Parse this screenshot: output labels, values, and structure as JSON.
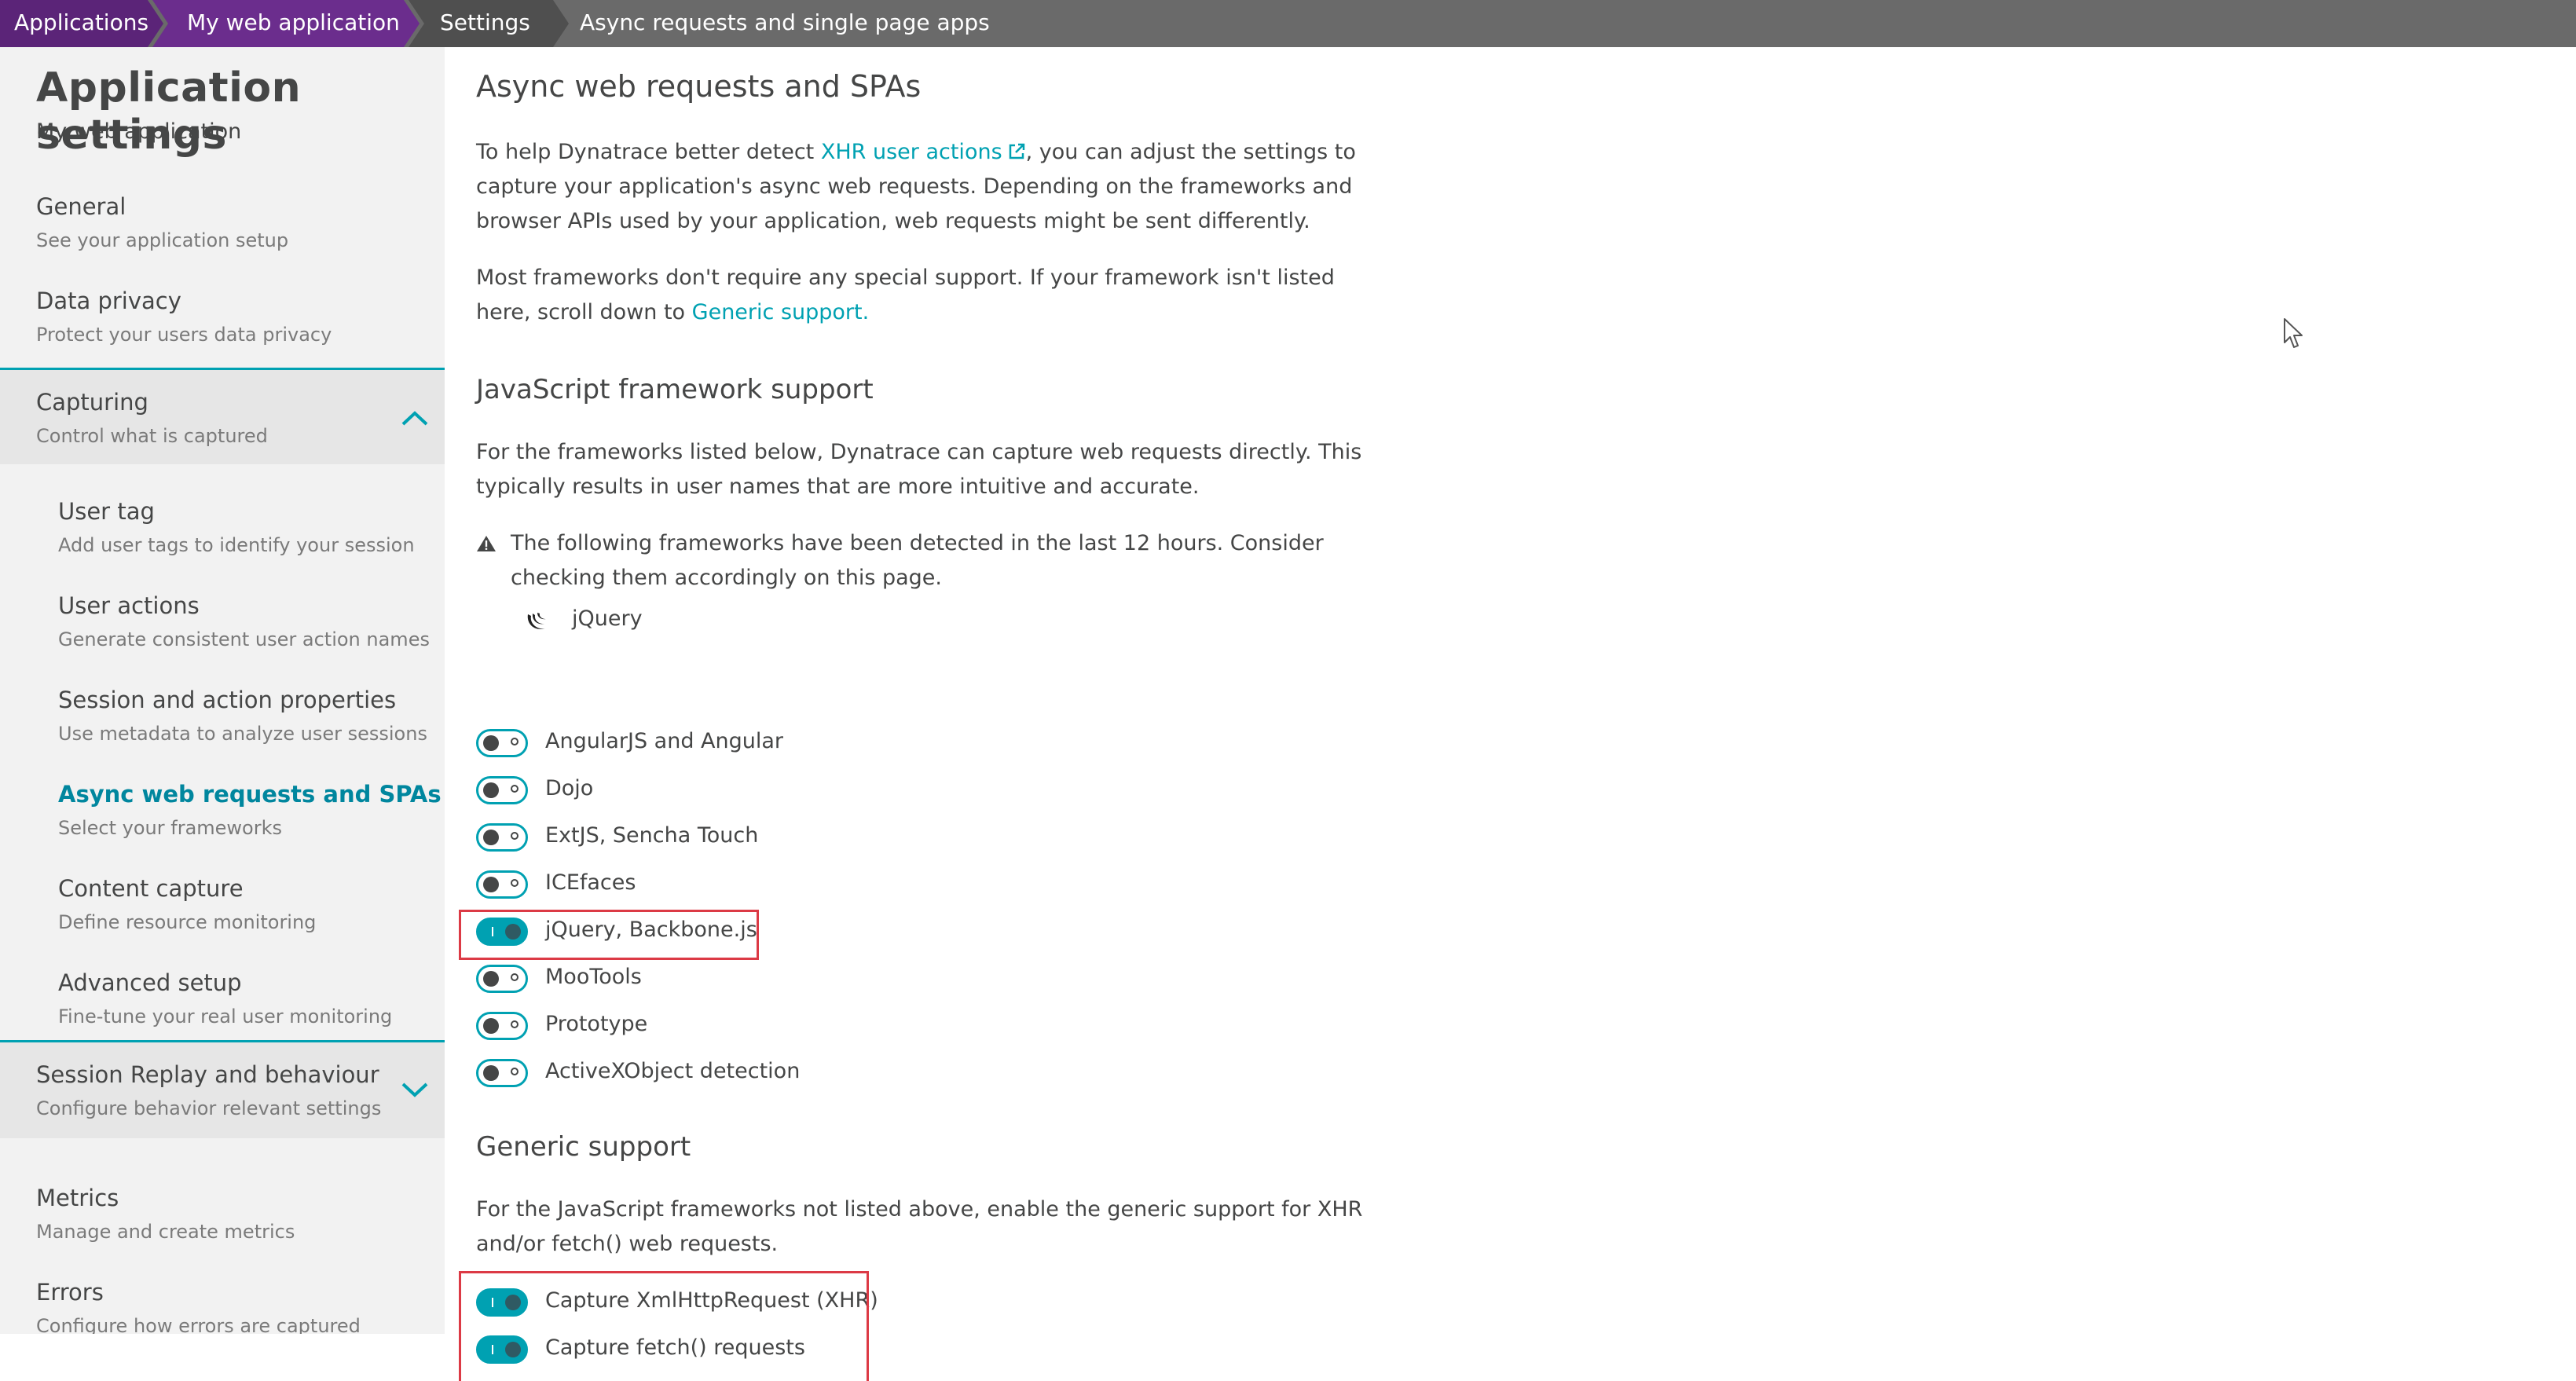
{
  "breadcrumb": {
    "items": [
      "Applications",
      "My web application",
      "Settings",
      "Async requests and single page apps"
    ]
  },
  "sidebar": {
    "title": "Application settings",
    "subtitle": "My web application",
    "items": [
      {
        "label": "General",
        "desc": "See your application setup"
      },
      {
        "label": "Data privacy",
        "desc": "Protect your users data privacy"
      },
      {
        "label": "Capturing",
        "desc": "Control what is captured",
        "expanded": true
      },
      {
        "label": "User tag",
        "desc": "Add user tags to identify your session"
      },
      {
        "label": "User actions",
        "desc": "Generate consistent user action names"
      },
      {
        "label": "Session and action properties",
        "desc": "Use metadata to analyze user sessions"
      },
      {
        "label": "Async web requests and SPAs",
        "desc": "Select your frameworks",
        "active": true
      },
      {
        "label": "Content capture",
        "desc": "Define resource monitoring"
      },
      {
        "label": "Advanced setup",
        "desc": "Fine-tune your real user monitoring"
      },
      {
        "label": "Session Replay and behaviour",
        "desc": "Configure behavior relevant settings",
        "expanded": false
      },
      {
        "label": "Metrics",
        "desc": "Manage and create metrics"
      },
      {
        "label": "Errors",
        "desc": "Configure how errors are captured"
      }
    ]
  },
  "main": {
    "title": "Async web requests and SPAs",
    "intro_prefix": "To help Dynatrace better detect ",
    "intro_link": "XHR user actions",
    "intro_suffix": ", you can adjust the settings to capture your application's async web requests. Depending on the frameworks and browser APIs used by your application, web requests might be sent differently.",
    "frameworks_prefix": "Most frameworks don't require any special support. If your framework isn't listed here, scroll down to ",
    "frameworks_link": "Generic support.",
    "js_heading": "JavaScript framework support",
    "js_desc": "For the frameworks listed below, Dynatrace can capture web requests directly. This typically results in user names that are more intuitive and accurate.",
    "warning": "The following frameworks have been detected in the last 12 hours. Consider checking them accordingly on this page.",
    "detected_framework": "jQuery",
    "frameworks": [
      {
        "label": "AngularJS and Angular",
        "on": false
      },
      {
        "label": "Dojo",
        "on": false
      },
      {
        "label": "ExtJS, Sencha Touch",
        "on": false
      },
      {
        "label": "ICEfaces",
        "on": false
      },
      {
        "label": "jQuery, Backbone.js",
        "on": true
      },
      {
        "label": "MooTools",
        "on": false
      },
      {
        "label": "Prototype",
        "on": false
      },
      {
        "label": "ActiveXObject detection",
        "on": false
      }
    ],
    "generic_heading": "Generic support",
    "generic_desc": "For the JavaScript frameworks not listed above, enable the generic support for XHR and/or fetch() web requests.",
    "generic": [
      {
        "label": "Capture XmlHttpRequest (XHR)",
        "on": true
      },
      {
        "label": "Capture fetch() requests",
        "on": true
      }
    ]
  },
  "colors": {
    "accent": "#00a1b2",
    "breadcrumb_purple": "#6b2d8d",
    "highlight": "#dc3a45"
  }
}
